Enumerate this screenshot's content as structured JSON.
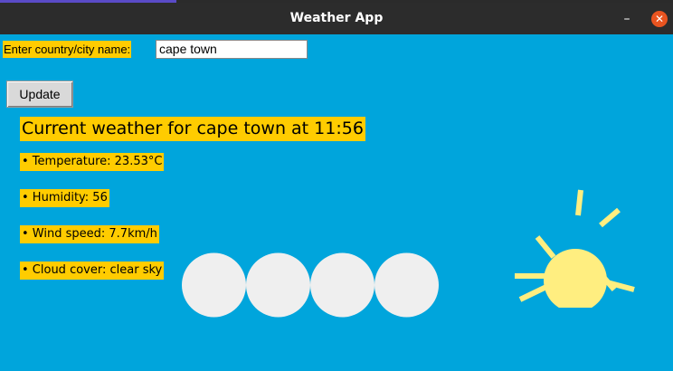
{
  "window": {
    "title": "Weather App",
    "minimize_glyph": "–",
    "close_glyph": "✕"
  },
  "form": {
    "city_label": "Enter country/city name:",
    "city_value": "cape town",
    "update_label": "Update"
  },
  "weather": {
    "heading": "Current weather for cape town at 11:56",
    "temperature": "• Temperature: 23.53°C",
    "humidity": "• Humidity: 56",
    "wind_speed": "• Wind speed: 7.7km/h",
    "cloud_cover": "• Cloud cover: clear sky"
  },
  "colors": {
    "background": "#00a5dc",
    "label_highlight": "#ffcc00",
    "sun": "#ffee80",
    "cloud": "#efefef",
    "close_button": "#e95420"
  },
  "icons": {
    "sun": "sun-icon",
    "clouds": "cloud-circles-icon"
  }
}
